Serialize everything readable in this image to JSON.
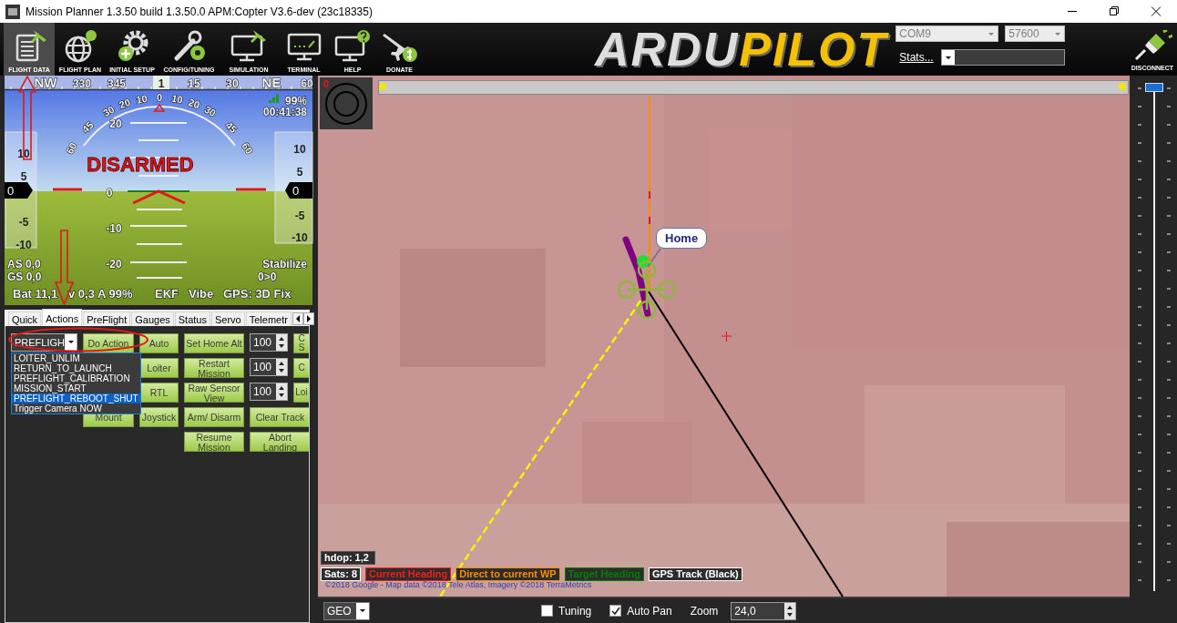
{
  "window": {
    "title": "Mission Planner 1.3.50 build 1.3.50.0 APM:Copter V3.6-dev (23c18335)"
  },
  "toolbar": {
    "nav": [
      {
        "label": "FLIGHT DATA",
        "selected": true
      },
      {
        "label": "FLIGHT PLAN",
        "selected": false
      },
      {
        "label": "INITIAL SETUP",
        "selected": false
      },
      {
        "label": "CONFIG/TUNING",
        "selected": false
      },
      {
        "label": "SIMULATION",
        "selected": false
      },
      {
        "label": "TERMINAL",
        "selected": false
      },
      {
        "label": "HELP",
        "selected": false
      },
      {
        "label": "DONATE",
        "selected": false
      }
    ],
    "logo": [
      "ARDU",
      "PILOT"
    ],
    "port": "COM9",
    "baud": "57600",
    "stats_link": "Stats...",
    "disconnect": "DISCONNECT"
  },
  "hud": {
    "compass": [
      "NW",
      "330",
      "345",
      "1",
      "15",
      "30",
      "NE",
      "60"
    ],
    "roll_scale": [
      "60",
      "45",
      "30",
      "20",
      "10",
      "0",
      "10",
      "20",
      "30",
      "45",
      "60"
    ],
    "pitch_labels": [
      "20",
      "0",
      "-10",
      "-20"
    ],
    "arm_status": "DISARMED",
    "speed_tape": [
      "10",
      "5",
      "0",
      "-5",
      "-10"
    ],
    "alt_tape": [
      "10",
      "5",
      "0",
      "-5",
      "-10"
    ],
    "battery_percent": "99%",
    "timer": "00:41:38",
    "airspeed": "AS 0,0",
    "groundspeed": "GS 0,0",
    "mode": "Stabilize",
    "waypoint": "0>0",
    "status_line": [
      "Bat 11,1",
      "v 0,3 A 99%",
      "EKF",
      "Vibe",
      "GPS: 3D Fix"
    ]
  },
  "tabs": [
    {
      "label": "Quick",
      "selected": false
    },
    {
      "label": "Actions",
      "selected": true
    },
    {
      "label": "PreFlight",
      "selected": false
    },
    {
      "label": "Gauges",
      "selected": false
    },
    {
      "label": "Status",
      "selected": false
    },
    {
      "label": "Servo",
      "selected": false
    },
    {
      "label": "Telemetr",
      "selected": false
    }
  ],
  "actions": {
    "command_combo": "PREFLIGH",
    "dropdown": [
      {
        "label": "LOITER_UNLIM",
        "selected": false
      },
      {
        "label": "RETURN_TO_LAUNCH",
        "selected": false
      },
      {
        "label": "PREFLIGHT_CALIBRATION",
        "selected": false
      },
      {
        "label": "MISSION_START",
        "selected": false
      },
      {
        "label": "PREFLIGHT_REBOOT_SHUT",
        "selected": true
      },
      {
        "label": "Trigger Camera NOW",
        "selected": false
      }
    ],
    "rows": [
      [
        {
          "kind": "combo"
        },
        {
          "kind": "button",
          "label": "Do Action"
        },
        {
          "kind": "button",
          "label": "Auto"
        },
        {
          "kind": "button",
          "label": "Set Home Alt"
        },
        {
          "kind": "spinner",
          "value": "100"
        },
        {
          "kind": "button",
          "label": "C S"
        }
      ],
      [
        {
          "kind": "blank"
        },
        {
          "kind": "blank"
        },
        {
          "kind": "button",
          "label": "Loiter"
        },
        {
          "kind": "button",
          "label": "Restart Mission"
        },
        {
          "kind": "spinner",
          "value": "100"
        },
        {
          "kind": "button",
          "label": "C"
        }
      ],
      [
        {
          "kind": "blank"
        },
        {
          "kind": "blank"
        },
        {
          "kind": "button",
          "label": "RTL"
        },
        {
          "kind": "button",
          "label": "Raw Sensor View"
        },
        {
          "kind": "spinner",
          "value": "100"
        },
        {
          "kind": "button",
          "label": "Loi"
        }
      ],
      [
        {
          "kind": "blank"
        },
        {
          "kind": "button",
          "label": "Mount"
        },
        {
          "kind": "button",
          "label": "Joystick"
        },
        {
          "kind": "button",
          "label": "Arm/ Disarm"
        },
        {
          "kind": "wide",
          "label": "Clear Track"
        }
      ],
      [
        {
          "kind": "blank"
        },
        {
          "kind": "blank"
        },
        {
          "kind": "blank"
        },
        {
          "kind": "button",
          "label": "Resume Mission"
        },
        {
          "kind": "wide",
          "label": "Abort Landing"
        }
      ]
    ]
  },
  "map": {
    "heading_marker": "0",
    "home_label": "Home",
    "hdop": "hdop: 1,2",
    "legend": [
      {
        "label": "Sats: 8",
        "color": "#ffffff"
      },
      {
        "label": "Current Heading",
        "color": "#ff1a1a"
      },
      {
        "label": "Direct to current WP",
        "color": "#ff8c00"
      },
      {
        "label": "Target Heading",
        "color": "#008000"
      },
      {
        "label": "GPS Track (Black)",
        "color": "#ffffff"
      }
    ],
    "attribution": "©2018 Google - Map data ©2018 Tele Atlas, Imagery ©2018 TerraMetrics"
  },
  "map_bottom": {
    "coord_type": "GEO",
    "options": [
      {
        "label": "Tuning",
        "checked": false
      },
      {
        "label": "Auto Pan",
        "checked": true
      }
    ],
    "zoom_label": "Zoom",
    "zoom": "24,0"
  },
  "zoom_slider": {
    "level": 1
  }
}
